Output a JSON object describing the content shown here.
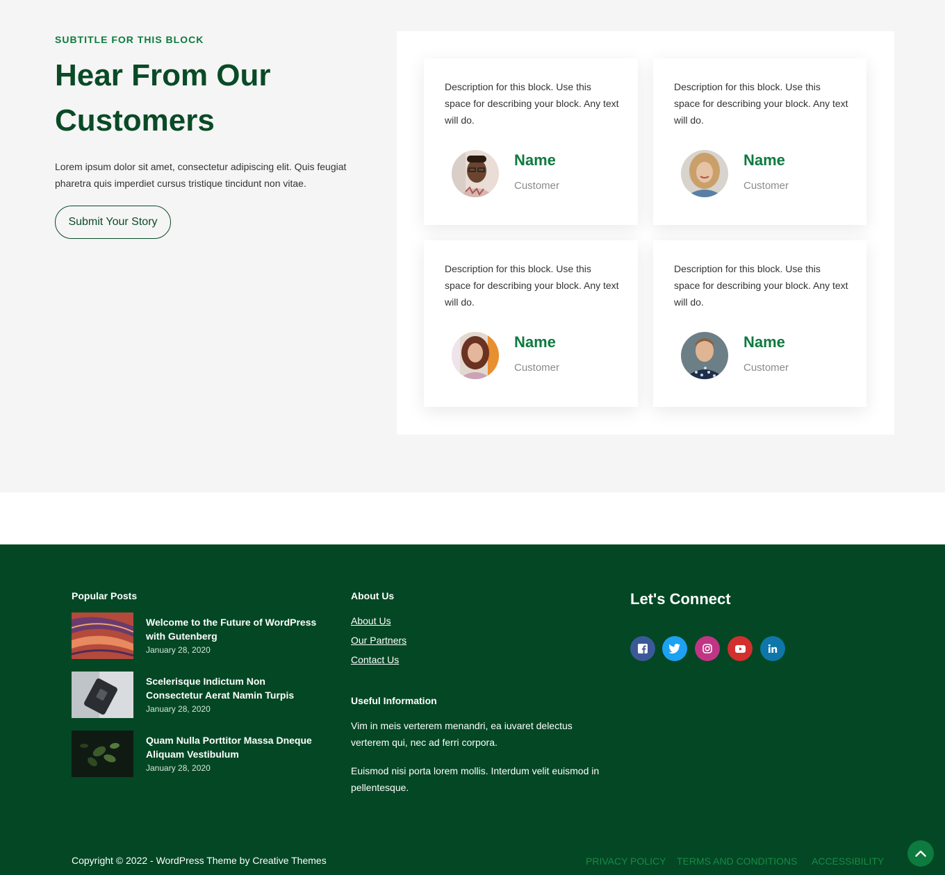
{
  "testimonials": {
    "subtitle": "SUBTITLE FOR THIS BLOCK",
    "heading": "Hear From Our Customers",
    "intro": "Lorem ipsum dolor sit amet, consectetur adipiscing elit. Quis feugiat pharetra quis imperdiet cursus tristique tincidunt non vitae.",
    "cta_label": "Submit Your Story",
    "cards": [
      {
        "description": "Description for this block. Use this space for describing your block. Any text will do.",
        "name": "Name",
        "role": "Customer"
      },
      {
        "description": "Description for this block. Use this space for describing your block. Any text will do.",
        "name": "Name",
        "role": "Customer"
      },
      {
        "description": "Description for this block. Use this space for describing your block. Any text will do.",
        "name": "Name",
        "role": "Customer"
      },
      {
        "description": "Description for this block. Use this space for describing your block. Any text will do.",
        "name": "Name",
        "role": "Customer"
      }
    ]
  },
  "footer": {
    "popular_posts": {
      "title": "Popular Posts",
      "posts": [
        {
          "title": "Welcome to the Future of WordPress with Gutenberg",
          "date": "January 28, 2020"
        },
        {
          "title": "Scelerisque Indictum Non Consectetur Aerat Namin Turpis",
          "date": "January 28, 2020"
        },
        {
          "title": "Quam Nulla Porttitor Massa Dneque Aliquam Vestibulum",
          "date": "January 28, 2020"
        }
      ]
    },
    "about": {
      "title": "About Us",
      "links": [
        "About Us",
        "Our Partners",
        "Contact Us"
      ]
    },
    "useful": {
      "title": "Useful Information",
      "paragraphs": [
        "Vim in meis verterem menandri, ea iuvaret delectus verterem qui, nec ad ferri corpora.",
        "Euismod nisi porta lorem mollis. Interdum velit euismod in pellentesque."
      ]
    },
    "connect": {
      "title": "Let's Connect",
      "socials": [
        {
          "icon": "facebook-icon",
          "color": "#3b5998"
        },
        {
          "icon": "twitter-icon",
          "color": "#1da1f2"
        },
        {
          "icon": "instagram-icon",
          "color": "#c13584"
        },
        {
          "icon": "youtube-icon",
          "color": "#d32f2f"
        },
        {
          "icon": "linkedin-icon",
          "color": "#0e76a8"
        }
      ]
    },
    "copyright": "Copyright © 2022 - WordPress Theme by Creative Themes",
    "legal_links": [
      "PRIVACY POLICY",
      "TERMS AND CONDITIONS",
      "ACCESSIBILITY"
    ]
  },
  "colors": {
    "brand_green": "#0d7a3e",
    "dark_green": "#0a4a26",
    "footer_bg": "#034724"
  }
}
